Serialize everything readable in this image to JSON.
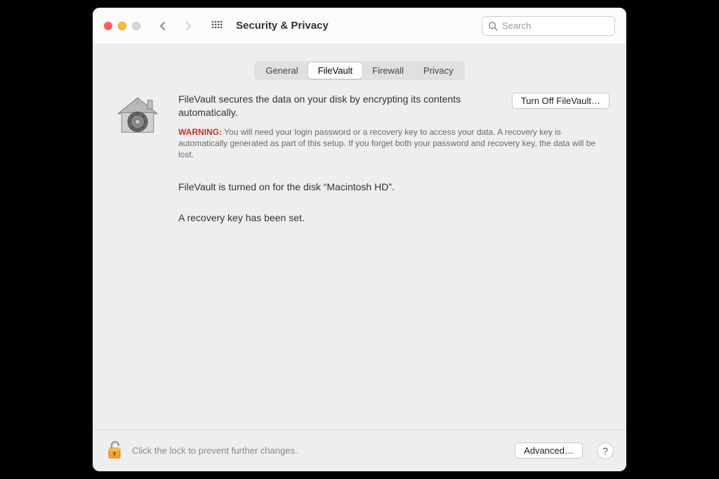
{
  "window": {
    "title": "Security & Privacy"
  },
  "search": {
    "placeholder": "Search",
    "value": ""
  },
  "tabs": {
    "items": [
      "General",
      "FileVault",
      "Firewall",
      "Privacy"
    ],
    "active_index": 1
  },
  "main": {
    "description": "FileVault secures the data on your disk by encrypting its contents automatically.",
    "button_label": "Turn Off FileVault…",
    "warning_label": "WARNING:",
    "warning_text": "You will need your login password or a recovery key to access your data. A recovery key is automatically generated as part of this setup. If you forget both your password and recovery key, the data will be lost.",
    "status_1": "FileVault is turned on for the disk “Macintosh HD”.",
    "status_2": "A recovery key has been set."
  },
  "footer": {
    "lock_text": "Click the lock to prevent further changes.",
    "advanced_label": "Advanced…",
    "help_label": "?"
  },
  "icons": {
    "house_lock": "security-house-icon",
    "padlock": "unlocked-padlock-icon"
  },
  "colors": {
    "warning_red": "#d12a1f",
    "window_bg": "#eeeeee"
  }
}
